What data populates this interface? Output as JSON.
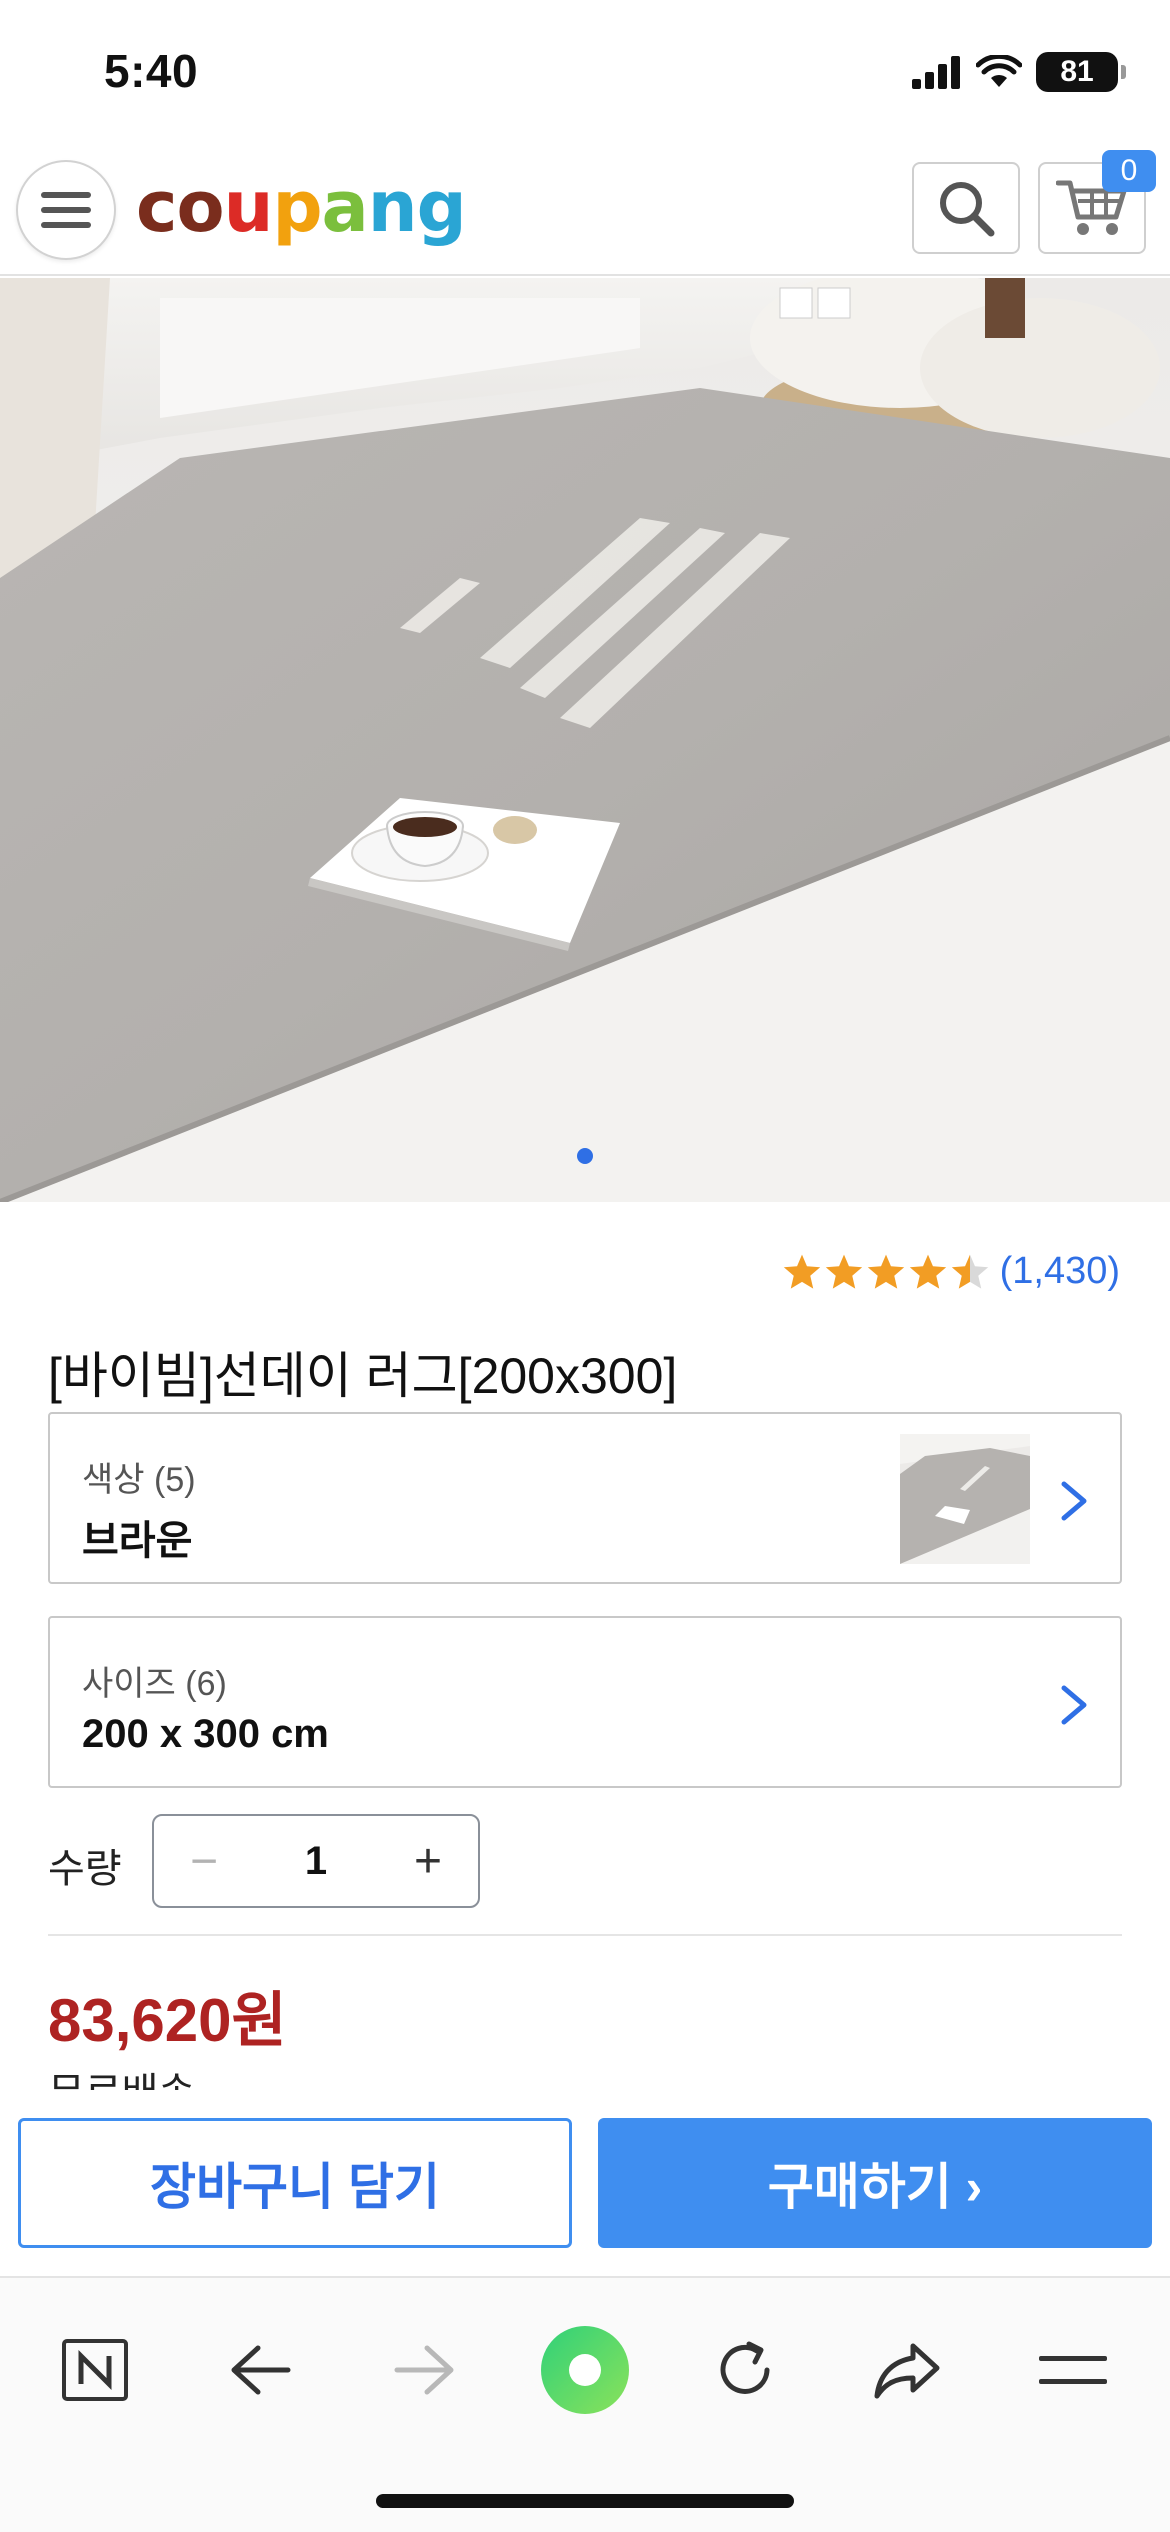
{
  "status_bar": {
    "time": "5:40",
    "battery": "81"
  },
  "header": {
    "logo": "coupang",
    "cart_count": "0"
  },
  "product": {
    "rating_stars": 4.5,
    "review_count": "(1,430)",
    "title": "[바이빔]선데이 러그[200x300]",
    "image_dot_count": 1
  },
  "options": {
    "color": {
      "label": "색상 (5)",
      "value": "브라운"
    },
    "size": {
      "label": "사이즈 (6)",
      "value": "200 x 300 cm"
    }
  },
  "quantity": {
    "label": "수량",
    "value": "1",
    "minus": "−",
    "plus": "+"
  },
  "price": {
    "amount": "83,620원",
    "shipping": "무료배송"
  },
  "actions": {
    "add_to_cart": "장바구니 담기",
    "buy_now": "구매하기 ›"
  },
  "colors": {
    "accent": "#3f8ef0",
    "price": "#ae2322",
    "star": "#f29d24",
    "link": "#2f6fe5"
  },
  "browser_toolbar": {
    "icons": [
      "naver-n-icon",
      "back-icon",
      "forward-icon",
      "green-dot-icon",
      "refresh-icon",
      "share-icon",
      "menu-icon"
    ]
  }
}
